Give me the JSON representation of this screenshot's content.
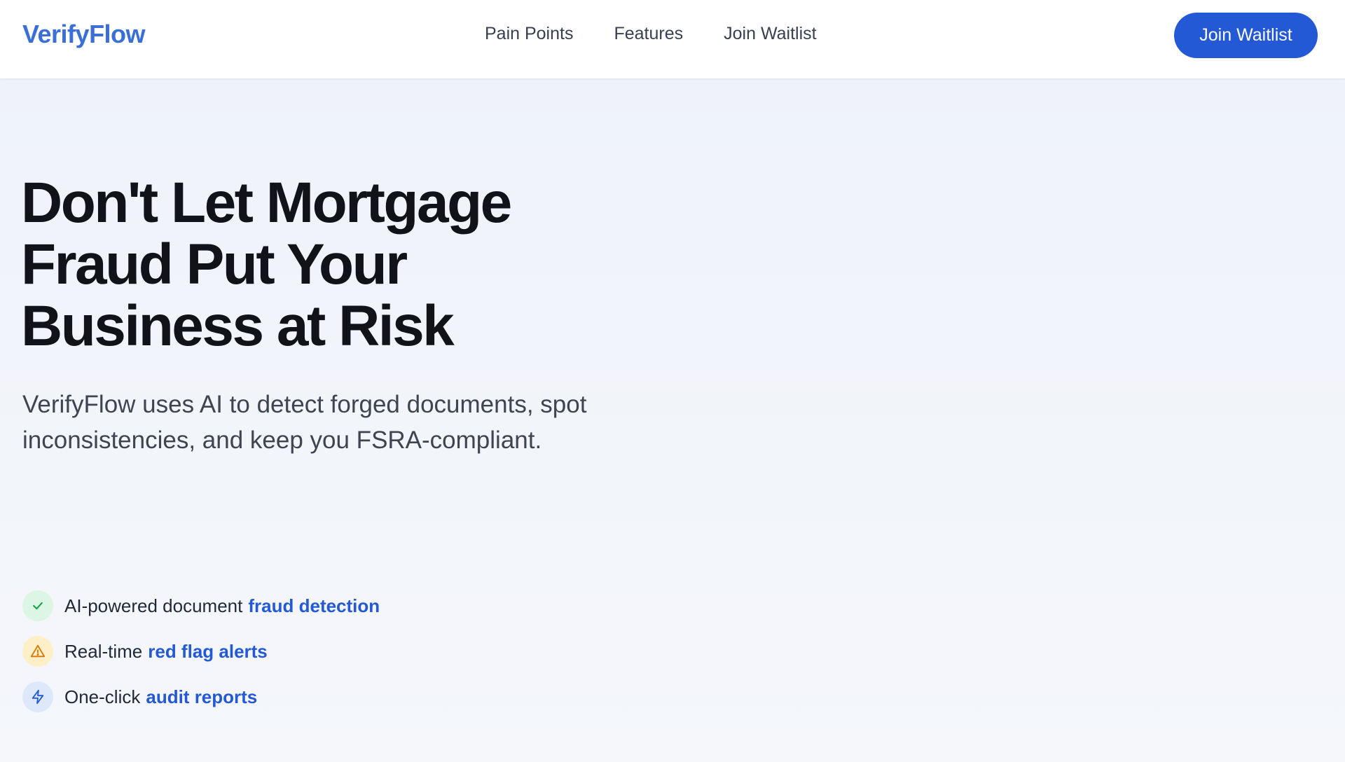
{
  "nav": {
    "logo": "VerifyFlow",
    "links": [
      "Pain Points",
      "Features",
      "Join Waitlist"
    ],
    "cta_label": "Join Waitlist"
  },
  "hero": {
    "title_lines": [
      "Don't Let Mortgage",
      "Fraud Put Your",
      "Business at Risk"
    ],
    "subtitle_lines": [
      "VerifyFlow uses AI to detect forged documents, spot",
      "inconsistencies, and keep you FSRA-compliant."
    ]
  },
  "features": [
    {
      "icon": "check-icon",
      "icon_bg": "#dcf5e5",
      "icon_color": "#16a34a",
      "text": "AI-powered document",
      "highlight": "fraud detection"
    },
    {
      "icon": "warning-icon",
      "icon_bg": "#fdf0c8",
      "icon_color": "#d97706",
      "text": "Real-time",
      "highlight": "red flag alerts"
    },
    {
      "icon": "lightning-icon",
      "icon_bg": "#dde8fb",
      "icon_color": "#2459d6",
      "text": "One-click",
      "highlight": "audit reports"
    }
  ],
  "colors": {
    "accent": "#2459d6",
    "logo": "#3a6fd8"
  }
}
